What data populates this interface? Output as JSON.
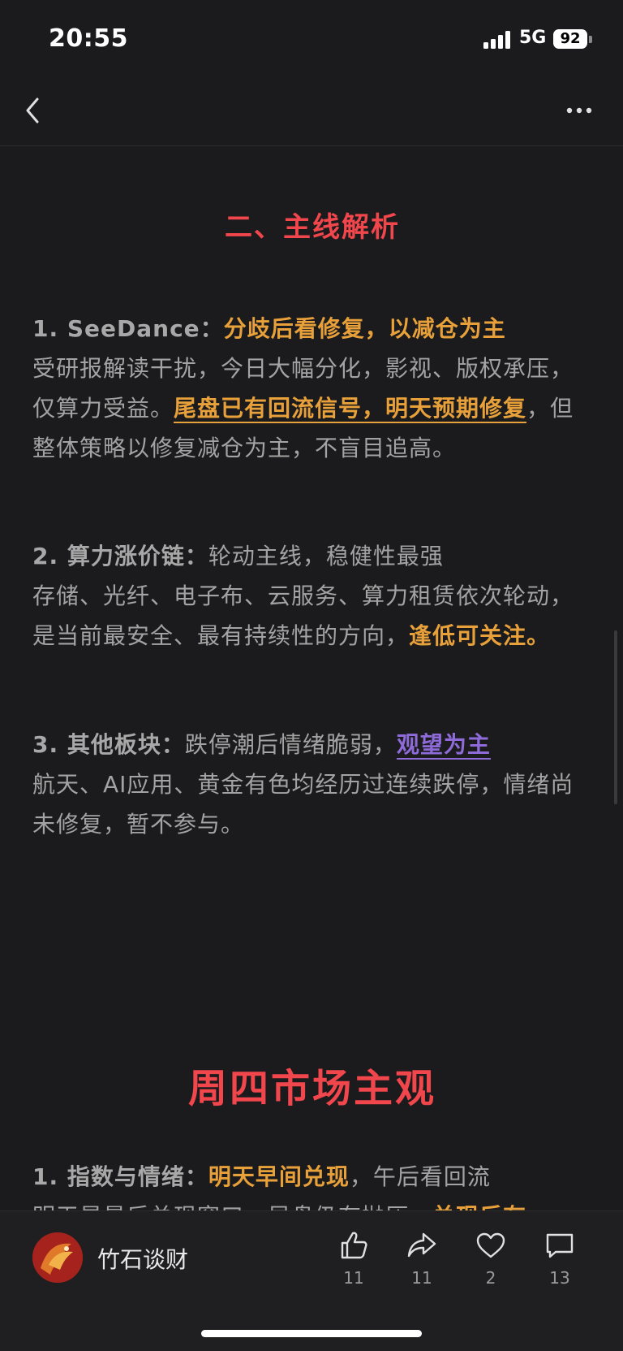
{
  "status_bar": {
    "time": "20:55",
    "network": "5G",
    "battery": "92"
  },
  "section1": {
    "title": "二、主线解析",
    "items": [
      {
        "lead": "1. SeeDance：",
        "highlight": "分歧后看修复，以减仓为主",
        "text_a": "受研报解读干扰，今日大幅分化，影视、版权承压，仅算力受益。",
        "highlight_b": "尾盘已有回流信号，明天预期修复",
        "text_b": "，但整体策略以修复减仓为主，不盲目追高。"
      },
      {
        "lead": "2. 算力涨价链：",
        "text_head": "轮动主线，稳健性最强",
        "text_a": "存储、光纤、电子布、云服务、算力租赁依次轮动，是当前最安全、最有持续性的方向，",
        "highlight_b": "逢低可关注。"
      },
      {
        "lead": "3. 其他板块：",
        "text_head": "跌停潮后情绪脆弱，",
        "highlight": "观望为主",
        "text_a": "航天、AI应用、黄金有色均经历过连续跌停，情绪尚未修复，暂不参与。"
      }
    ]
  },
  "section2": {
    "title": "周四市场主观",
    "item1": {
      "lead": "1. 指数与情绪：",
      "highlight": "明天早间兑现",
      "text": "，午后看回流"
    },
    "cut_line_text": "明天是最后兑现窗口，早盘仍有抛压，",
    "cut_line_highlight": "兑现后有"
  },
  "bottom_bar": {
    "author": "竹石谈财",
    "like_count": "11",
    "share_count": "11",
    "favorite_count": "2",
    "comment_count": "13"
  },
  "colors": {
    "accent_red": "#f0464c",
    "accent_orange": "#e8a13a",
    "accent_purple": "#8e6bd8"
  }
}
